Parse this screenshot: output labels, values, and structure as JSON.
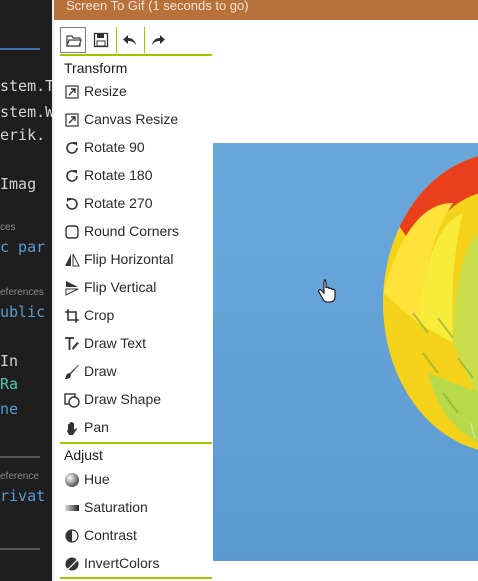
{
  "editor": {
    "lines": [
      {
        "text": "stem.T",
        "kind": "code",
        "color": "#d4d4d4"
      },
      {
        "text": "stem.W",
        "kind": "code",
        "color": "#d4d4d4"
      },
      {
        "text": "erik.",
        "kind": "code",
        "color": "#d4d4d4"
      },
      {
        "text": "Imag",
        "kind": "code",
        "color": "#d4d4d4"
      },
      {
        "text": "ces",
        "kind": "small",
        "color": "#8a8a8a"
      },
      {
        "text": "c par",
        "kind": "code",
        "color": "#569cd6"
      },
      {
        "text": "eferences",
        "kind": "small",
        "color": "#8a8a8a"
      },
      {
        "text": "ublic",
        "kind": "code",
        "color": "#569cd6"
      },
      {
        "text": "In",
        "kind": "code",
        "color": "#d4d4d4"
      },
      {
        "text": "Ra",
        "kind": "code",
        "color": "#4ec9b0"
      },
      {
        "text": "ne",
        "kind": "code",
        "color": "#569cd6"
      },
      {
        "text": "eference",
        "kind": "small",
        "color": "#8a8a8a"
      },
      {
        "text": "rivat",
        "kind": "code",
        "color": "#569cd6"
      }
    ]
  },
  "window": {
    "title": "Screen To Gif (1 seconds to go)",
    "accent_color": "#a3c400",
    "title_bar_color": "#b8713b"
  },
  "toolbar": {
    "buttons": [
      {
        "name": "open-button",
        "icon": "folder-open-icon"
      },
      {
        "name": "save-button",
        "icon": "floppy-disk-icon"
      },
      {
        "name": "undo-button",
        "icon": "undo-arrow-icon"
      },
      {
        "name": "redo-button",
        "icon": "redo-arrow-icon"
      }
    ]
  },
  "transform": {
    "title": "Transform",
    "items": [
      {
        "label": "Resize",
        "icon": "resize-icon"
      },
      {
        "label": "Canvas Resize",
        "icon": "canvas-resize-icon"
      },
      {
        "label": "Rotate 90",
        "icon": "rotate-90-icon"
      },
      {
        "label": "Rotate 180",
        "icon": "rotate-180-icon"
      },
      {
        "label": "Rotate 270",
        "icon": "rotate-270-icon"
      },
      {
        "label": "Round Corners",
        "icon": "round-corners-icon"
      },
      {
        "label": "Flip Horizontal",
        "icon": "flip-horizontal-icon"
      },
      {
        "label": "Flip Vertical",
        "icon": "flip-vertical-icon"
      },
      {
        "label": "Crop",
        "icon": "crop-icon"
      },
      {
        "label": "Draw Text",
        "icon": "draw-text-icon"
      },
      {
        "label": "Draw",
        "icon": "brush-icon"
      },
      {
        "label": "Draw Shape",
        "icon": "draw-shape-icon"
      },
      {
        "label": "Pan",
        "icon": "hand-icon"
      }
    ]
  },
  "adjust": {
    "title": "Adjust",
    "items": [
      {
        "label": "Hue",
        "icon": "hue-icon"
      },
      {
        "label": "Saturation",
        "icon": "saturation-icon"
      },
      {
        "label": "Contrast",
        "icon": "contrast-icon"
      },
      {
        "label": "InvertColors",
        "icon": "invert-colors-icon"
      }
    ]
  },
  "preview": {
    "sky_color": "#5d9fd6",
    "balloon_colors": [
      "#e8401d",
      "#ffd21a",
      "#f7e81e",
      "#b8d94a"
    ]
  }
}
